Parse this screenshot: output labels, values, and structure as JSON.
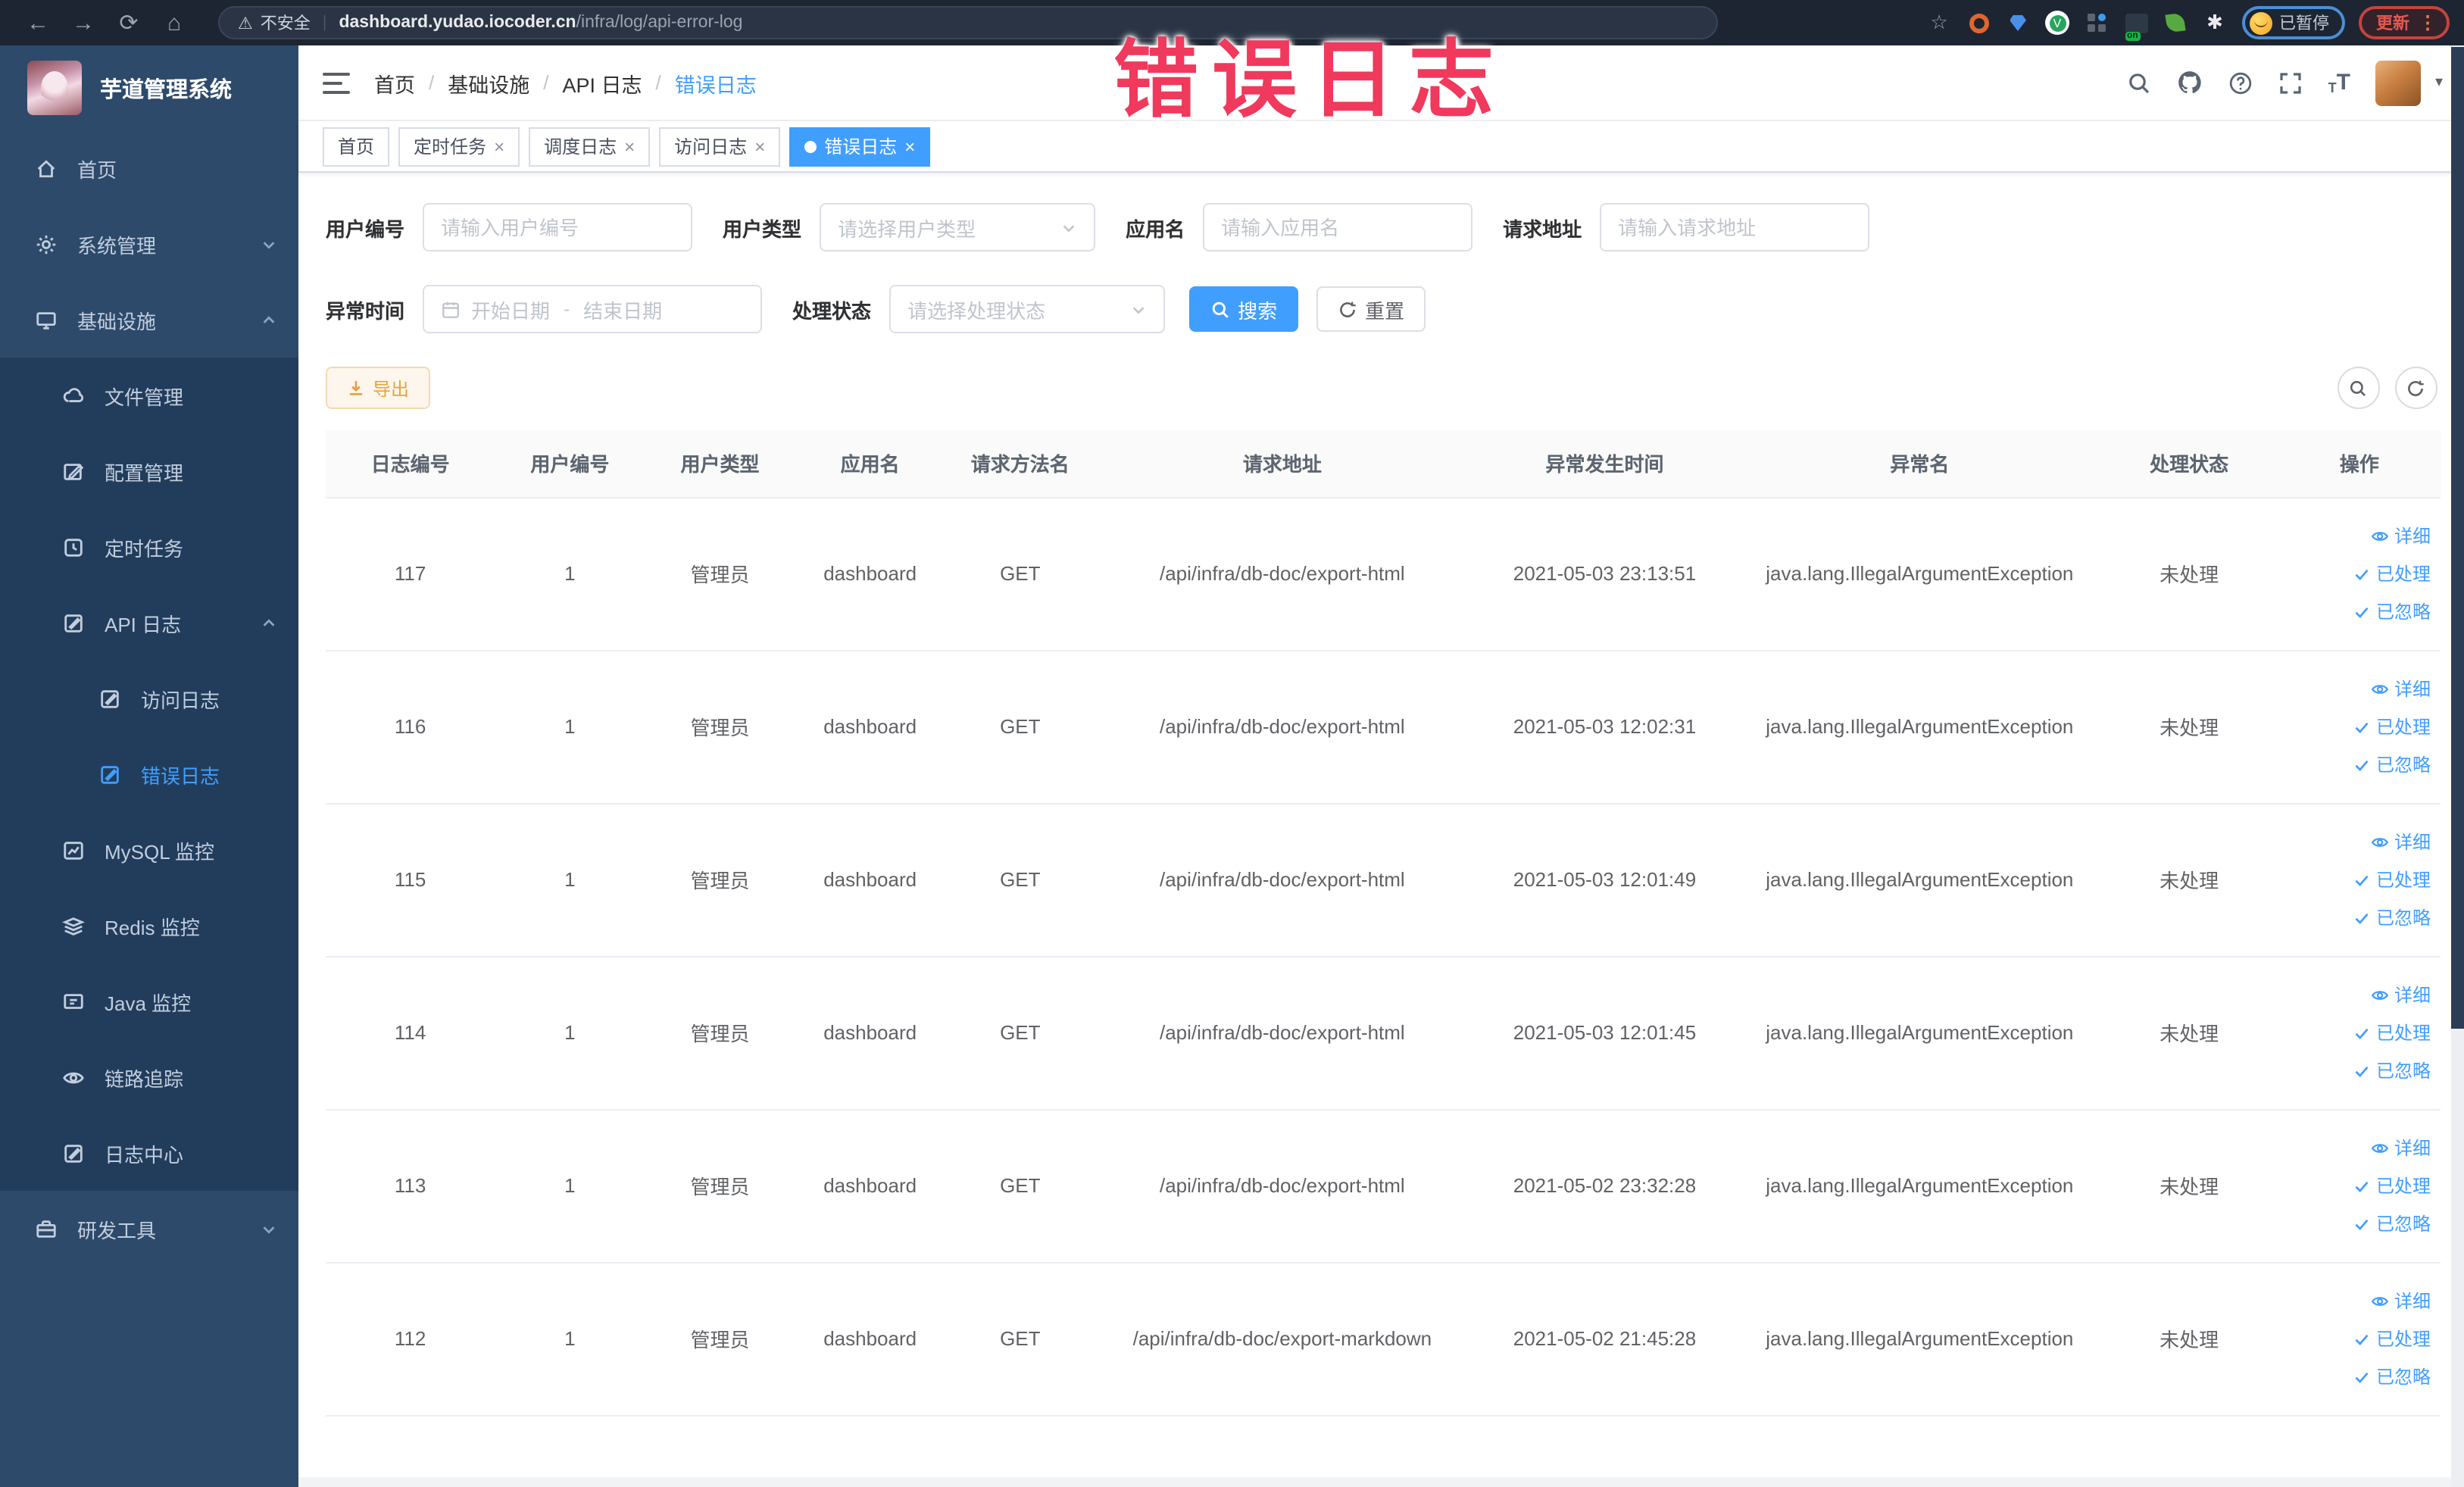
{
  "browser": {
    "security_label": "不安全",
    "url_host": "dashboard.yudao.iocoder.cn",
    "url_path": "/infra/log/api-error-log",
    "extension_badge": "on",
    "profile_label": "已暂停",
    "update_label": "更新"
  },
  "annotation": {
    "text": "错误日志",
    "color": "#f0395c"
  },
  "icons": {
    "back": "←",
    "forward": "→",
    "reload": "⟳",
    "home": "⌂",
    "warning": "⚠",
    "star": "☆",
    "puzzle": "✱",
    "kebab": "⋮",
    "divider": "|",
    "separator": "/",
    "caret": "▾",
    "close": "×",
    "check": "✓",
    "v_badge": "V",
    "font_large": "T",
    "font_small": "T",
    "range_sep": "-",
    "question": "?"
  },
  "sidebar": {
    "title": "芋道管理系统",
    "home": "首页",
    "system": "系统管理",
    "infra": "基础设施",
    "file": "文件管理",
    "config": "配置管理",
    "job": "定时任务",
    "api_log": "API 日志",
    "access_log": "访问日志",
    "error_log": "错误日志",
    "mysql": "MySQL 监控",
    "redis": "Redis 监控",
    "java": "Java 监控",
    "trace": "链路追踪",
    "log_center": "日志中心",
    "dev_tool": "研发工具"
  },
  "breadcrumb": {
    "items": [
      "首页",
      "基础设施",
      "API 日志",
      "错误日志"
    ]
  },
  "tabs": [
    {
      "label": "首页"
    },
    {
      "label": "定时任务"
    },
    {
      "label": "调度日志"
    },
    {
      "label": "访问日志"
    },
    {
      "label": "错误日志"
    }
  ],
  "filters": {
    "user_id_label": "用户编号",
    "user_id_placeholder": "请输入用户编号",
    "user_type_label": "用户类型",
    "user_type_placeholder": "请选择用户类型",
    "app_name_label": "应用名",
    "app_name_placeholder": "请输入应用名",
    "request_url_label": "请求地址",
    "request_url_placeholder": "请输入请求地址",
    "exception_time_label": "异常时间",
    "date_start_placeholder": "开始日期",
    "date_end_placeholder": "结束日期",
    "process_status_label": "处理状态",
    "process_status_placeholder": "请选择处理状态",
    "search_button": "搜索",
    "reset_button": "重置"
  },
  "toolbar": {
    "export_button": "导出"
  },
  "table": {
    "columns": [
      "日志编号",
      "用户编号",
      "用户类型",
      "应用名",
      "请求方法名",
      "请求地址",
      "异常发生时间",
      "异常名",
      "处理状态",
      "操作"
    ],
    "actions": {
      "detail": "详细",
      "processed": "已处理",
      "ignored": "已忽略"
    },
    "rows": [
      {
        "id": "117",
        "user_id": "1",
        "user_type": "管理员",
        "app": "dashboard",
        "method": "GET",
        "url": "/api/infra/db-doc/export-html",
        "time": "2021-05-03 23:13:51",
        "exception": "java.lang.IllegalArgumentException",
        "status": "未处理"
      },
      {
        "id": "116",
        "user_id": "1",
        "user_type": "管理员",
        "app": "dashboard",
        "method": "GET",
        "url": "/api/infra/db-doc/export-html",
        "time": "2021-05-03 12:02:31",
        "exception": "java.lang.IllegalArgumentException",
        "status": "未处理"
      },
      {
        "id": "115",
        "user_id": "1",
        "user_type": "管理员",
        "app": "dashboard",
        "method": "GET",
        "url": "/api/infra/db-doc/export-html",
        "time": "2021-05-03 12:01:49",
        "exception": "java.lang.IllegalArgumentException",
        "status": "未处理"
      },
      {
        "id": "114",
        "user_id": "1",
        "user_type": "管理员",
        "app": "dashboard",
        "method": "GET",
        "url": "/api/infra/db-doc/export-html",
        "time": "2021-05-03 12:01:45",
        "exception": "java.lang.IllegalArgumentException",
        "status": "未处理"
      },
      {
        "id": "113",
        "user_id": "1",
        "user_type": "管理员",
        "app": "dashboard",
        "method": "GET",
        "url": "/api/infra/db-doc/export-html",
        "time": "2021-05-02 23:32:28",
        "exception": "java.lang.IllegalArgumentException",
        "status": "未处理"
      },
      {
        "id": "112",
        "user_id": "1",
        "user_type": "管理员",
        "app": "dashboard",
        "method": "GET",
        "url": "/api/infra/db-doc/export-markdown",
        "time": "2021-05-02 21:45:28",
        "exception": "java.lang.IllegalArgumentException",
        "status": "未处理"
      }
    ]
  },
  "colors": {
    "accent": "#409eff",
    "warning": "#e6a23c",
    "annotation": "#f0395c",
    "sidebar_bg": "#2d4a6b",
    "submenu_bg": "#223d5c",
    "chrome_bg": "#1d2532"
  }
}
